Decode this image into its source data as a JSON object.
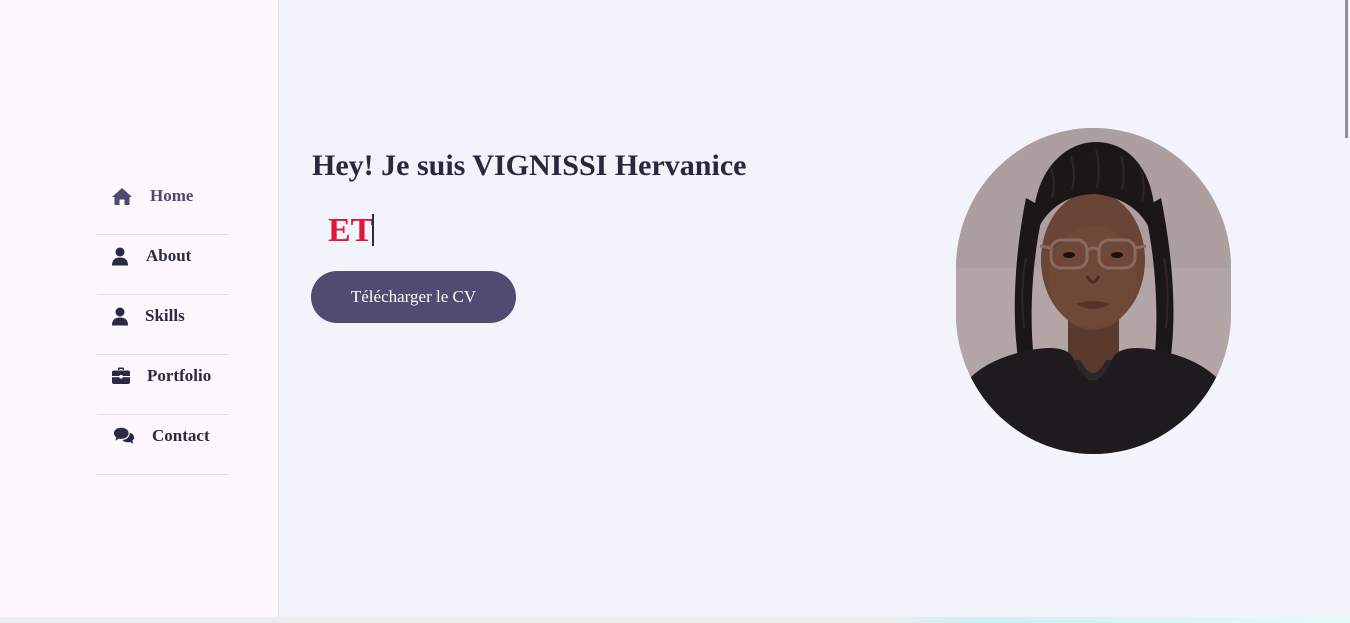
{
  "nav": {
    "items": [
      {
        "label": "Home",
        "icon": "home-icon"
      },
      {
        "label": "About",
        "icon": "user-icon"
      },
      {
        "label": "Skills",
        "icon": "user-icon"
      },
      {
        "label": "Portfolio",
        "icon": "briefcase-icon"
      },
      {
        "label": "Contact",
        "icon": "comments-icon"
      }
    ]
  },
  "hero": {
    "title": "Hey! Je suis VIGNISSI Hervanice",
    "typed_text": "ET",
    "cv_button_label": "Télécharger le CV"
  },
  "colors": {
    "accent": "#4f4c71",
    "typed_text": "#e0173b",
    "sidebar_bg": "#fdf8fd",
    "page_bg": "#f2f3fb"
  }
}
